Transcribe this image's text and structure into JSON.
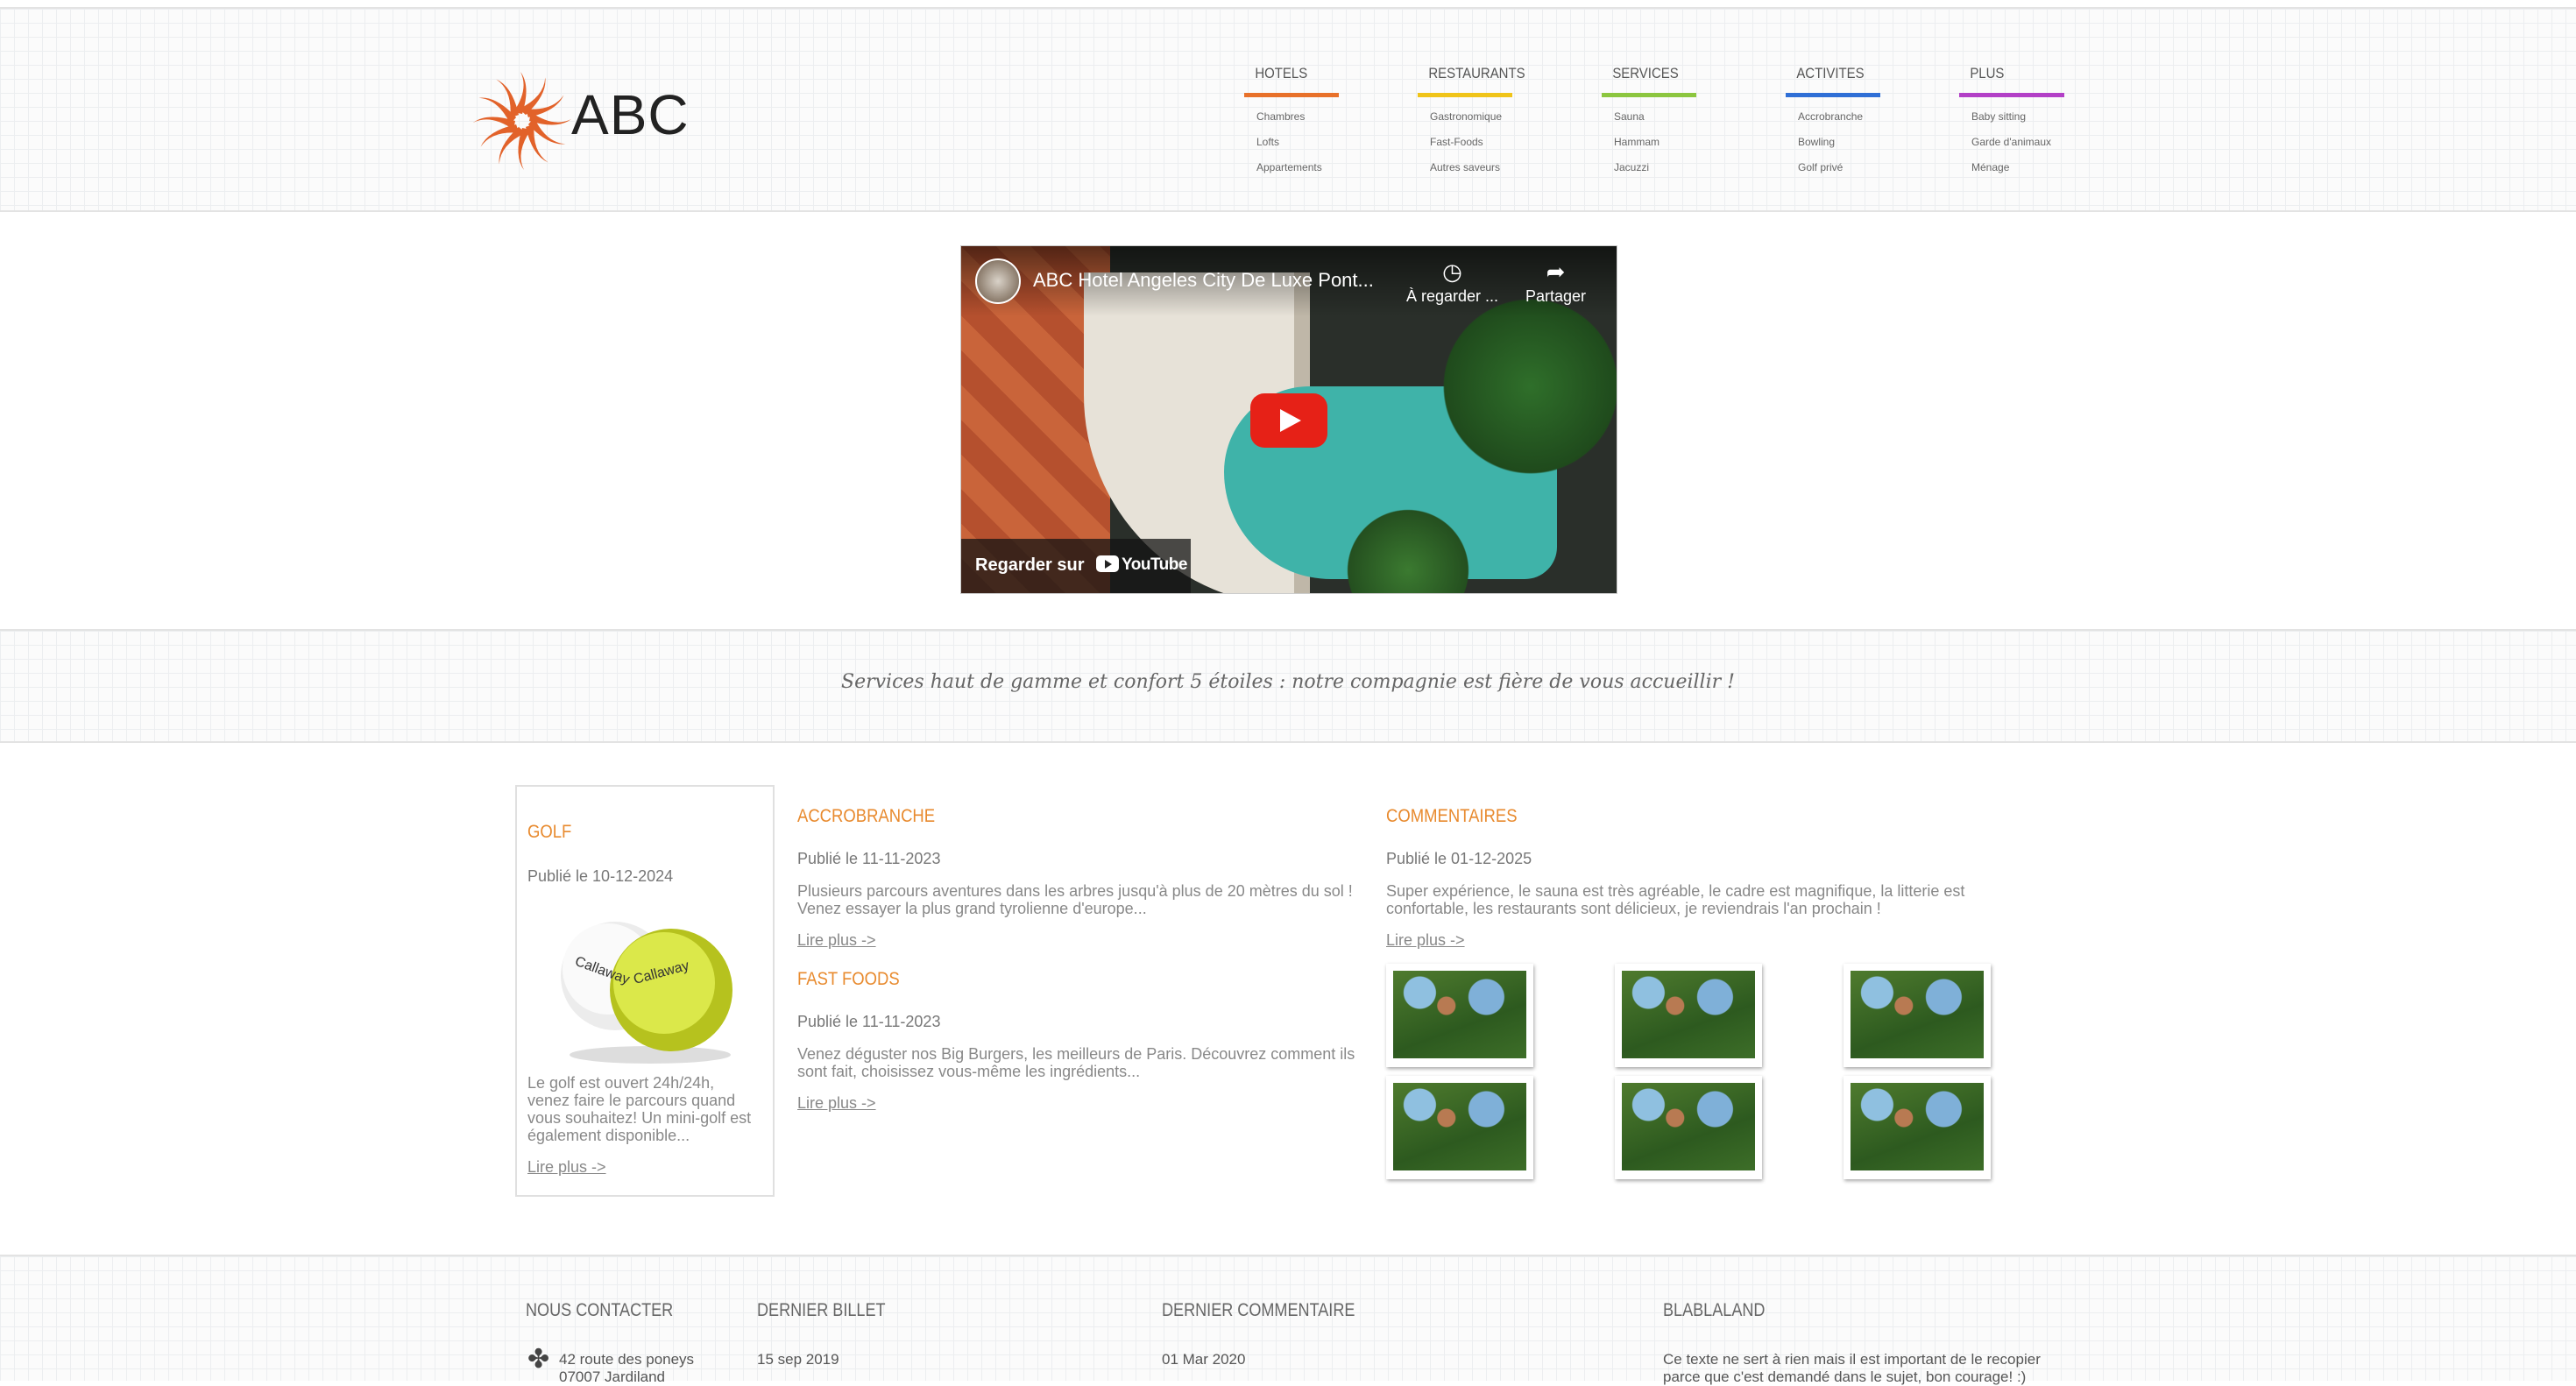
{
  "header": {
    "logo_text": "ABC",
    "menu": [
      {
        "title": "HOTELS",
        "color": "#e8712a",
        "items": [
          "Chambres",
          "Lofts",
          "Appartements"
        ]
      },
      {
        "title": "RESTAURANTS",
        "color": "#f0c419",
        "items": [
          "Gastronomique",
          "Fast-Foods",
          "Autres saveurs"
        ]
      },
      {
        "title": "SERVICES",
        "color": "#8cc63f",
        "items": [
          "Sauna",
          "Hammam",
          "Jacuzzi"
        ]
      },
      {
        "title": "ACTIVITES",
        "color": "#2f6fd6",
        "items": [
          "Accrobranche",
          "Bowling",
          "Golf privé"
        ]
      },
      {
        "title": "PLUS",
        "color": "#b340c7",
        "items": [
          "Baby sitting",
          "Garde d'animaux",
          "Ménage"
        ]
      }
    ]
  },
  "video": {
    "title": "ABC Hotel Angeles City De Luxe Pont...",
    "watch_later": "À regarder ...",
    "share": "Partager",
    "watch_on": "Regarder sur",
    "platform": "YouTube"
  },
  "tagline": "Services haut de gamme et confort 5 étoiles : notre compagnie est fière de vous accueillir !",
  "golf": {
    "title": "GOLF",
    "date": "Publié le 10-12-2024",
    "excerpt": "Le golf est ouvert 24h/24h, venez faire le parcours quand vous souhaitez! Un mini-golf est également disponible...",
    "more": "Lire plus ->"
  },
  "posts": [
    {
      "title": "ACCROBRANCHE",
      "date": "Publié le 11-11-2023",
      "excerpt": "Plusieurs parcours aventures dans les arbres jusqu'à plus de 20 mètres du sol ! Venez essayer la plus grand tyrolienne d'europe...",
      "more": "Lire plus ->"
    },
    {
      "title": "FAST FOODS",
      "date": "Publié le 11-11-2023",
      "excerpt": "Venez déguster nos Big Burgers, les meilleurs de Paris. Découvrez comment ils sont fait, choisissez vous-même les ingrédients...",
      "more": "Lire plus ->"
    }
  ],
  "commentaires": {
    "title": "COMMENTAIRES",
    "date": "Publié le 01-12-2025",
    "excerpt": "Super expérience, le sauna est très agréable, le cadre est magnifique, la litterie est confortable, les restaurants sont délicieux, je reviendrais l'an prochain !",
    "more": "Lire plus ->"
  },
  "footer": {
    "contact": {
      "title": "NOUS CONTACTER",
      "line1": "42 route des poneys",
      "line2": "07007 Jardiland"
    },
    "billet": {
      "title": "DERNIER BILLET",
      "date": "15 sep 2019"
    },
    "commentaire": {
      "title": "DERNIER COMMENTAIRE",
      "date": "01 Mar 2020"
    },
    "blabla": {
      "title": "BLABLALAND",
      "text1": "Ce texte ne sert à rien mais il est important de le recopier",
      "text2": "parce que c'est demandé dans le sujet, bon courage! :)"
    }
  }
}
